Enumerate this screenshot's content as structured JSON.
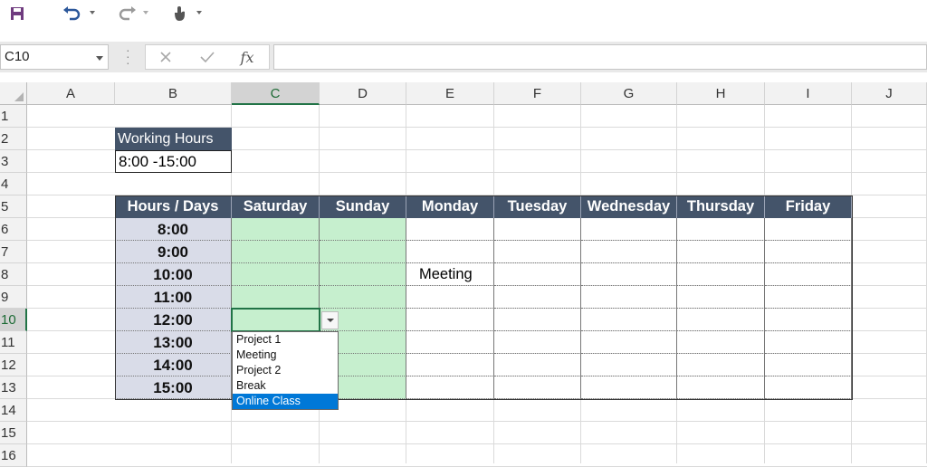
{
  "toolbar": {
    "save": "save-icon",
    "undo": "undo-icon",
    "redo": "redo-icon",
    "touch": "touch-mode-icon"
  },
  "formula_bar": {
    "name_box": "C10",
    "fx_label": "fx",
    "formula": ""
  },
  "columns": [
    "A",
    "B",
    "C",
    "D",
    "E",
    "F",
    "G",
    "H",
    "I",
    "J"
  ],
  "rows": [
    "1",
    "2",
    "3",
    "4",
    "5",
    "6",
    "7",
    "8",
    "9",
    "10",
    "11",
    "12",
    "13",
    "14",
    "15",
    "16"
  ],
  "selected": {
    "column": "C",
    "row": "10"
  },
  "sheet": {
    "working_hours_label": "Working Hours",
    "working_hours_value": "8:00 -15:00",
    "table_header": [
      "Hours / Days",
      "Saturday",
      "Sunday",
      "Monday",
      "Tuesday",
      "Wednesday",
      "Thursday",
      "Friday"
    ],
    "hours": [
      "8:00",
      "9:00",
      "10:00",
      "11:00",
      "12:00",
      "13:00",
      "14:00",
      "15:00"
    ],
    "entries": [
      {
        "day": "Monday",
        "hour": "10:00",
        "text": "Meeting"
      }
    ]
  },
  "dropdown": {
    "options": [
      "Project 1",
      "Meeting",
      "Project 2",
      "Break",
      "Online Class"
    ],
    "highlighted": "Online Class"
  },
  "colors": {
    "header_fill": "#44546a",
    "hours_fill": "#d9dce8",
    "weekend_fill": "#c6efce",
    "selection": "#217346",
    "dropdown_highlight": "#0078d7"
  }
}
